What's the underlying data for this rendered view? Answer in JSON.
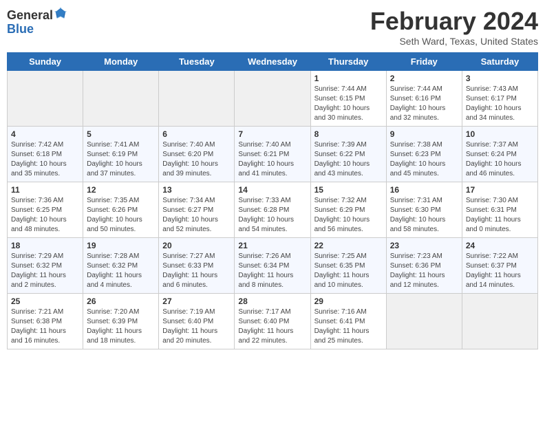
{
  "header": {
    "logo_general": "General",
    "logo_blue": "Blue",
    "month_title": "February 2024",
    "location": "Seth Ward, Texas, United States"
  },
  "days_of_week": [
    "Sunday",
    "Monday",
    "Tuesday",
    "Wednesday",
    "Thursday",
    "Friday",
    "Saturday"
  ],
  "weeks": [
    [
      {
        "day": "",
        "info": ""
      },
      {
        "day": "",
        "info": ""
      },
      {
        "day": "",
        "info": ""
      },
      {
        "day": "",
        "info": ""
      },
      {
        "day": "1",
        "info": "Sunrise: 7:44 AM\nSunset: 6:15 PM\nDaylight: 10 hours\nand 30 minutes."
      },
      {
        "day": "2",
        "info": "Sunrise: 7:44 AM\nSunset: 6:16 PM\nDaylight: 10 hours\nand 32 minutes."
      },
      {
        "day": "3",
        "info": "Sunrise: 7:43 AM\nSunset: 6:17 PM\nDaylight: 10 hours\nand 34 minutes."
      }
    ],
    [
      {
        "day": "4",
        "info": "Sunrise: 7:42 AM\nSunset: 6:18 PM\nDaylight: 10 hours\nand 35 minutes."
      },
      {
        "day": "5",
        "info": "Sunrise: 7:41 AM\nSunset: 6:19 PM\nDaylight: 10 hours\nand 37 minutes."
      },
      {
        "day": "6",
        "info": "Sunrise: 7:40 AM\nSunset: 6:20 PM\nDaylight: 10 hours\nand 39 minutes."
      },
      {
        "day": "7",
        "info": "Sunrise: 7:40 AM\nSunset: 6:21 PM\nDaylight: 10 hours\nand 41 minutes."
      },
      {
        "day": "8",
        "info": "Sunrise: 7:39 AM\nSunset: 6:22 PM\nDaylight: 10 hours\nand 43 minutes."
      },
      {
        "day": "9",
        "info": "Sunrise: 7:38 AM\nSunset: 6:23 PM\nDaylight: 10 hours\nand 45 minutes."
      },
      {
        "day": "10",
        "info": "Sunrise: 7:37 AM\nSunset: 6:24 PM\nDaylight: 10 hours\nand 46 minutes."
      }
    ],
    [
      {
        "day": "11",
        "info": "Sunrise: 7:36 AM\nSunset: 6:25 PM\nDaylight: 10 hours\nand 48 minutes."
      },
      {
        "day": "12",
        "info": "Sunrise: 7:35 AM\nSunset: 6:26 PM\nDaylight: 10 hours\nand 50 minutes."
      },
      {
        "day": "13",
        "info": "Sunrise: 7:34 AM\nSunset: 6:27 PM\nDaylight: 10 hours\nand 52 minutes."
      },
      {
        "day": "14",
        "info": "Sunrise: 7:33 AM\nSunset: 6:28 PM\nDaylight: 10 hours\nand 54 minutes."
      },
      {
        "day": "15",
        "info": "Sunrise: 7:32 AM\nSunset: 6:29 PM\nDaylight: 10 hours\nand 56 minutes."
      },
      {
        "day": "16",
        "info": "Sunrise: 7:31 AM\nSunset: 6:30 PM\nDaylight: 10 hours\nand 58 minutes."
      },
      {
        "day": "17",
        "info": "Sunrise: 7:30 AM\nSunset: 6:31 PM\nDaylight: 11 hours\nand 0 minutes."
      }
    ],
    [
      {
        "day": "18",
        "info": "Sunrise: 7:29 AM\nSunset: 6:32 PM\nDaylight: 11 hours\nand 2 minutes."
      },
      {
        "day": "19",
        "info": "Sunrise: 7:28 AM\nSunset: 6:32 PM\nDaylight: 11 hours\nand 4 minutes."
      },
      {
        "day": "20",
        "info": "Sunrise: 7:27 AM\nSunset: 6:33 PM\nDaylight: 11 hours\nand 6 minutes."
      },
      {
        "day": "21",
        "info": "Sunrise: 7:26 AM\nSunset: 6:34 PM\nDaylight: 11 hours\nand 8 minutes."
      },
      {
        "day": "22",
        "info": "Sunrise: 7:25 AM\nSunset: 6:35 PM\nDaylight: 11 hours\nand 10 minutes."
      },
      {
        "day": "23",
        "info": "Sunrise: 7:23 AM\nSunset: 6:36 PM\nDaylight: 11 hours\nand 12 minutes."
      },
      {
        "day": "24",
        "info": "Sunrise: 7:22 AM\nSunset: 6:37 PM\nDaylight: 11 hours\nand 14 minutes."
      }
    ],
    [
      {
        "day": "25",
        "info": "Sunrise: 7:21 AM\nSunset: 6:38 PM\nDaylight: 11 hours\nand 16 minutes."
      },
      {
        "day": "26",
        "info": "Sunrise: 7:20 AM\nSunset: 6:39 PM\nDaylight: 11 hours\nand 18 minutes."
      },
      {
        "day": "27",
        "info": "Sunrise: 7:19 AM\nSunset: 6:40 PM\nDaylight: 11 hours\nand 20 minutes."
      },
      {
        "day": "28",
        "info": "Sunrise: 7:17 AM\nSunset: 6:40 PM\nDaylight: 11 hours\nand 22 minutes."
      },
      {
        "day": "29",
        "info": "Sunrise: 7:16 AM\nSunset: 6:41 PM\nDaylight: 11 hours\nand 25 minutes."
      },
      {
        "day": "",
        "info": ""
      },
      {
        "day": "",
        "info": ""
      }
    ]
  ]
}
